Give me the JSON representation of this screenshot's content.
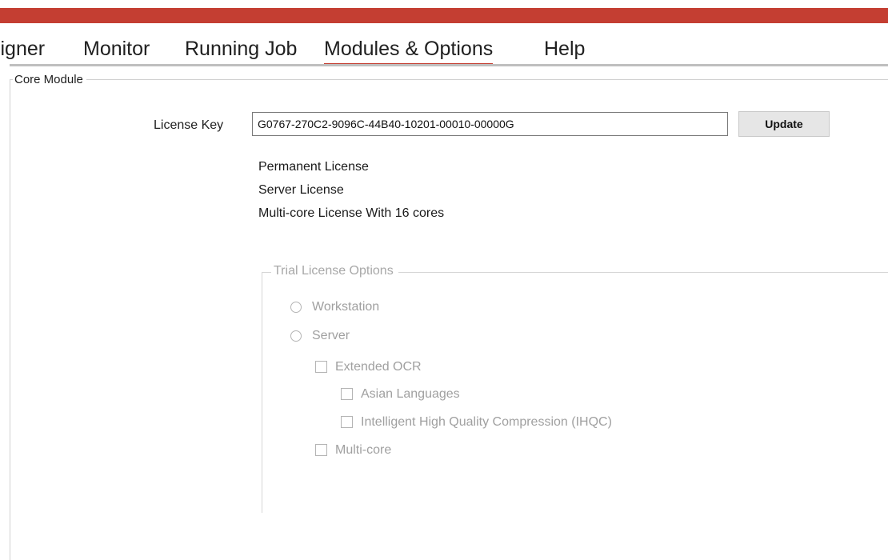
{
  "header": {
    "accent_color": "#c43e32"
  },
  "tabs": [
    {
      "label": "signer"
    },
    {
      "label": "Monitor"
    },
    {
      "label": "Running Job"
    },
    {
      "label": "Modules & Options",
      "active": true
    },
    {
      "label": "Help"
    }
  ],
  "core_module": {
    "legend": "Core Module",
    "license_key_label": "License Key",
    "license_key_value": "G0767-270C2-9096C-44B40-10201-00010-00000G",
    "update_label": "Update",
    "license_lines": [
      "Permanent License",
      "Server License",
      "Multi-core License With 16 cores"
    ]
  },
  "trial_options": {
    "legend": "Trial License Options",
    "radios": [
      {
        "label": "Workstation",
        "checked": false
      },
      {
        "label": "Server",
        "checked": false
      }
    ],
    "checkboxes": [
      {
        "label": "Extended OCR",
        "checked": false
      },
      {
        "label": "Asian Languages",
        "checked": false
      },
      {
        "label": "Intelligent High Quality Compression (IHQC)",
        "checked": false
      },
      {
        "label": "Multi-core",
        "checked": false
      }
    ]
  }
}
